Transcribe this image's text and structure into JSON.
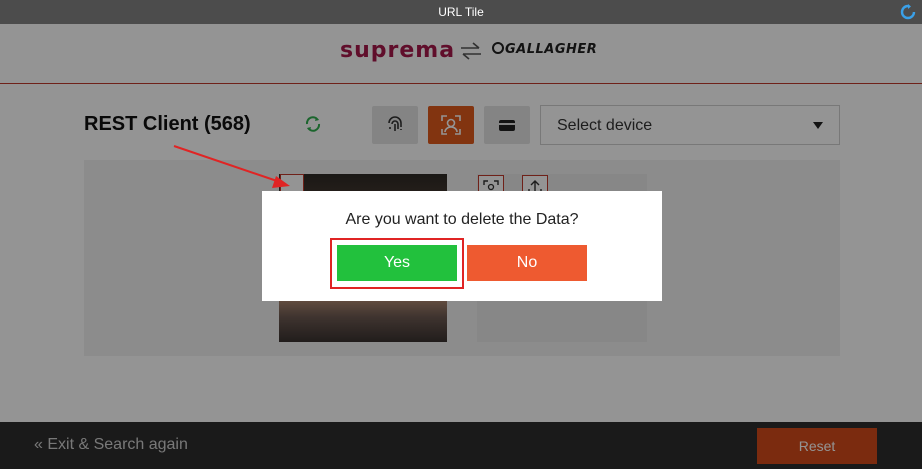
{
  "window": {
    "title": "URL Tile",
    "refresh_icon": "refresh-icon"
  },
  "header": {
    "logo_left": "suprema",
    "swap_icon": "swap-arrows-icon",
    "logo_right": "GALLAGHER",
    "brand_color": "#a5194a",
    "accent_line": "#c0392b"
  },
  "main": {
    "client_title": "REST Client (568)",
    "sync_icon": "sync-icon",
    "tools": [
      {
        "name": "fingerprint",
        "icon": "fingerprint-icon",
        "active": false
      },
      {
        "name": "face",
        "icon": "face-scan-icon",
        "active": true
      },
      {
        "name": "card",
        "icon": "card-icon",
        "active": false
      }
    ],
    "device_select": {
      "value": "Select device",
      "icon": "chevron-down-icon"
    },
    "photo_tools": [
      "face-capture-icon",
      "upload-icon"
    ],
    "active_color": "#e05a1c"
  },
  "dialog": {
    "message": "Are you want to delete the Data?",
    "yes_label": "Yes",
    "no_label": "No",
    "yes_color": "#22c13d",
    "no_color": "#ee5a30"
  },
  "footer": {
    "exit_label": "Exit & Search again",
    "exit_icon": "double-chevron-left-icon",
    "reset_label": "Reset"
  }
}
